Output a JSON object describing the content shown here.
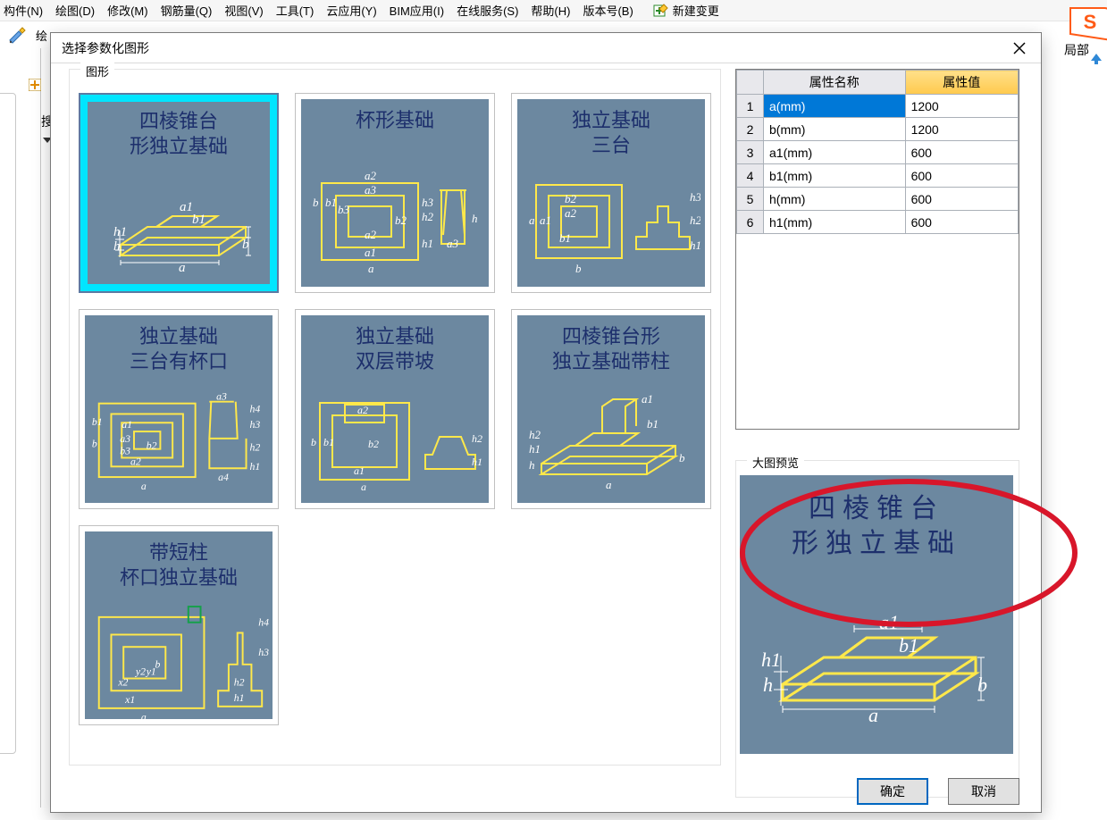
{
  "menu": {
    "items": [
      "构件(N)",
      "绘图(D)",
      "修改(M)",
      "钢筋量(Q)",
      "视图(V)",
      "工具(T)",
      "云应用(Y)",
      "BIM应用(I)",
      "在线服务(S)",
      "帮助(H)",
      "版本号(B)"
    ],
    "new_change": "新建变更"
  },
  "toolbar": {
    "draw_label": "绘"
  },
  "left": {
    "search_label": "搜"
  },
  "overflow": {
    "partial_label": "局部"
  },
  "dialog": {
    "title": "选择参数化图形",
    "shape_group": "图形",
    "preview_group": "大图预览",
    "ok": "确定",
    "cancel": "取消"
  },
  "prop_table": {
    "col_name": "属性名称",
    "col_value": "属性值",
    "rows": [
      {
        "idx": "1",
        "name": "a(mm)",
        "value": "1200"
      },
      {
        "idx": "2",
        "name": "b(mm)",
        "value": "1200"
      },
      {
        "idx": "3",
        "name": "a1(mm)",
        "value": "600"
      },
      {
        "idx": "4",
        "name": "b1(mm)",
        "value": "600"
      },
      {
        "idx": "5",
        "name": "h(mm)",
        "value": "600"
      },
      {
        "idx": "6",
        "name": "h1(mm)",
        "value": "600"
      }
    ]
  },
  "shapes": [
    {
      "title1": "四棱锥台",
      "title2": "形独立基础",
      "selected": true
    },
    {
      "title1": "杯形基础",
      "title2": ""
    },
    {
      "title1": "独立基础",
      "title2": "三台"
    },
    {
      "title1": "独立基础",
      "title2": "三台有杯口"
    },
    {
      "title1": "独立基础",
      "title2": "双层带坡"
    },
    {
      "title1": "四棱锥台形",
      "title2": "独立基础带柱"
    },
    {
      "title1": "带短柱",
      "title2": "杯口独立基础"
    }
  ],
  "preview": {
    "title1": "四棱锥台",
    "title2": "形独立基础"
  }
}
